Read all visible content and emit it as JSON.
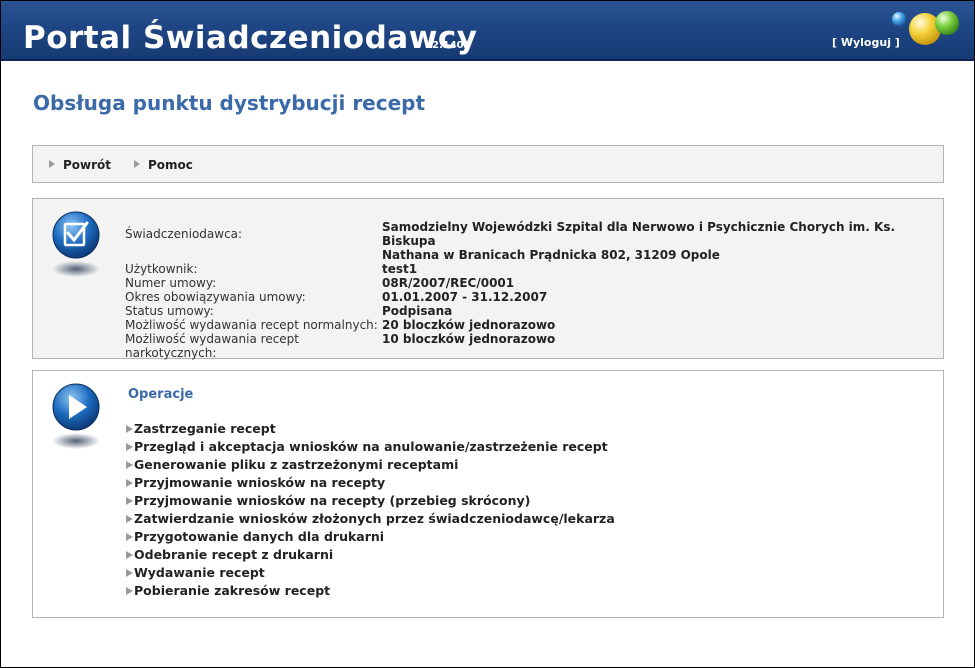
{
  "header": {
    "title": "Portal Świadczeniodawcy",
    "version": "2.1401",
    "logout_label": "[ Wyloguj ]"
  },
  "page": {
    "title": "Obsługa punktu dystrybucji recept"
  },
  "toolbar": {
    "items": [
      {
        "label": "Powrót"
      },
      {
        "label": "Pomoc"
      }
    ]
  },
  "info": {
    "rows": [
      {
        "label": "Świadczeniodawca:",
        "value_line1": "Samodzielny Wojewódzki Szpital dla Nerwowo i Psychicznie Chorych im. Ks. Biskupa",
        "value_line2": "Nathana w Branicach Prądnicka 802, 31209 Opole"
      },
      {
        "label": "Użytkownik:",
        "value": "test1"
      },
      {
        "label": "Numer umowy:",
        "value": "08R/2007/REC/0001"
      },
      {
        "label": "Okres obowiązywania umowy:",
        "value": "01.01.2007 - 31.12.2007"
      },
      {
        "label": "Status umowy:",
        "value": "Podpisana"
      },
      {
        "label": "Możliwość wydawania recept normalnych:",
        "value": "20 bloczków jednorazowo"
      },
      {
        "label": "Możliwość wydawania recept narkotycznych:",
        "value": "10 bloczków jednorazowo"
      }
    ]
  },
  "operations": {
    "title": "Operacje",
    "items": [
      {
        "label": "Zastrzeganie recept"
      },
      {
        "label": "Przegląd i akceptacja wniosków na anulowanie/zastrzeżenie recept"
      },
      {
        "label": "Generowanie pliku z zastrzeżonymi receptami"
      },
      {
        "label": "Przyjmowanie wniosków na recepty"
      },
      {
        "label": "Przyjmowanie wniosków na recepty (przebieg skrócony)"
      },
      {
        "label": "Zatwierdzanie wniosków złożonych przez świadczeniodawcę/lekarza"
      },
      {
        "label": "Przygotowanie danych dla drukarni"
      },
      {
        "label": "Odebranie recept z drukarni"
      },
      {
        "label": "Wydawanie recept"
      },
      {
        "label": "Pobieranie zakresów recept"
      }
    ]
  },
  "colors": {
    "header_blue": "#1f4684",
    "accent_blue": "#3b6aa8",
    "panel_gray": "#f3f3f3"
  }
}
